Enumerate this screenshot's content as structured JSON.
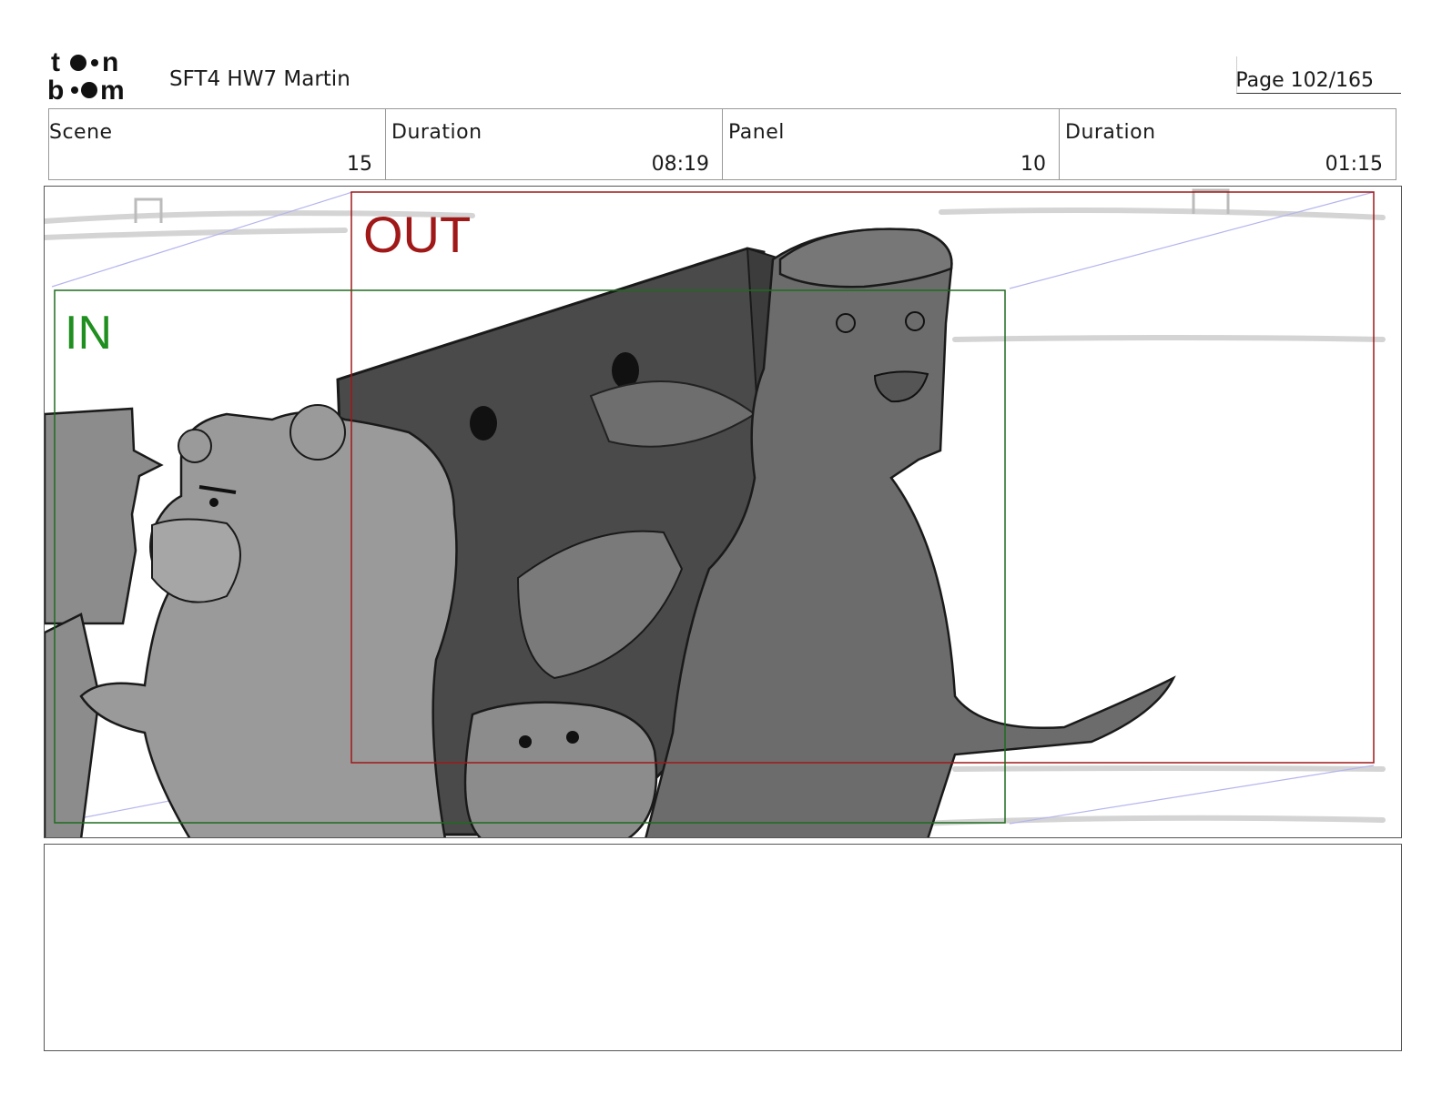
{
  "header": {
    "logo_line1": "toon",
    "logo_line2": "boom",
    "project_title": "SFT4 HW7 Martin",
    "page_label": "Page 102/165"
  },
  "info": {
    "scene_label": "Scene",
    "scene_value": "15",
    "scene_duration_label": "Duration",
    "scene_duration_value": "08:19",
    "panel_label": "Panel",
    "panel_value": "10",
    "panel_duration_label": "Duration",
    "panel_duration_value": "01:15"
  },
  "panel": {
    "in_label": "IN",
    "out_label": "OUT",
    "in_color": "#1f8f1f",
    "out_color": "#a01818"
  },
  "notes": {
    "text": ""
  }
}
